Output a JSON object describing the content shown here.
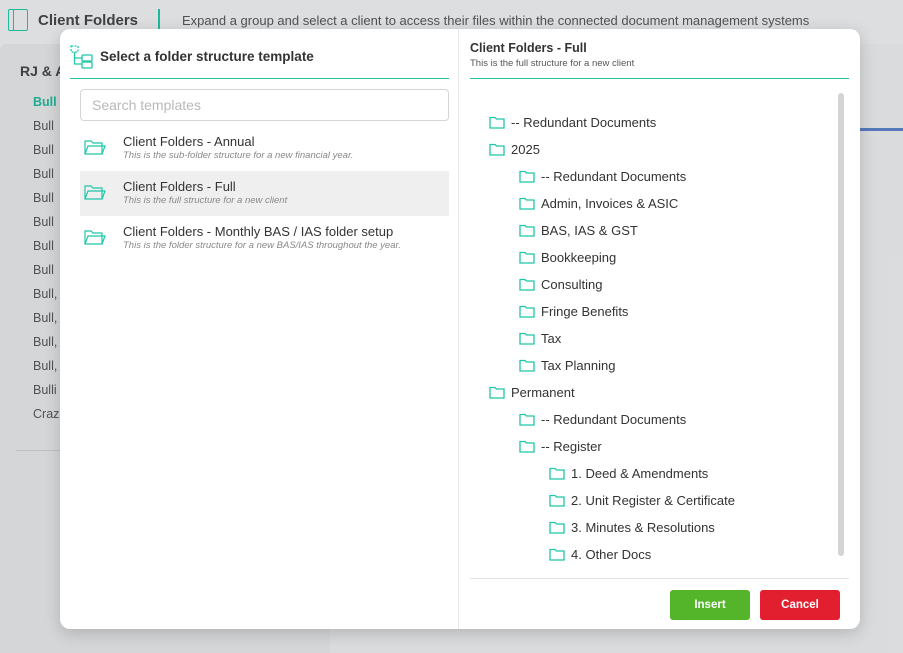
{
  "app": {
    "title": "Client Folders",
    "description": "Expand a group and select a client to access their files within the connected document management systems",
    "group_title": "RJ & A",
    "clients": [
      "Bull",
      "Bull",
      "Bull",
      "Bull",
      "Bull",
      "Bull",
      "Bull",
      "Bull",
      "Bull,",
      "Bull,",
      "Bull,",
      "Bull,",
      "Bulli",
      "Craz"
    ]
  },
  "modal": {
    "left_title": "Select a folder structure template",
    "search": {
      "placeholder": "Search templates",
      "value": ""
    },
    "templates": [
      {
        "name": "Client Folders - Annual",
        "desc": "This is the sub-folder structure for a new financial year.",
        "selected": false
      },
      {
        "name": "Client Folders - Full",
        "desc": "This is the full structure for a new client",
        "selected": true
      },
      {
        "name": "Client Folders - Monthly BAS / IAS folder setup",
        "desc": "This is the folder structure for a new BAS/IAS throughout the year.",
        "selected": false
      }
    ],
    "preview_title": "Client Folders - Full",
    "preview_subtitle": "This is the full structure for a new client",
    "tree": [
      {
        "name": "-- Redundant Documents",
        "level": 0
      },
      {
        "name": "2025",
        "level": 0
      },
      {
        "name": "-- Redundant Documents",
        "level": 1
      },
      {
        "name": "Admin, Invoices & ASIC",
        "level": 1
      },
      {
        "name": "BAS, IAS & GST",
        "level": 1
      },
      {
        "name": "Bookkeeping",
        "level": 1
      },
      {
        "name": "Consulting",
        "level": 1
      },
      {
        "name": "Fringe Benefits",
        "level": 1
      },
      {
        "name": "Tax",
        "level": 1
      },
      {
        "name": "Tax Planning",
        "level": 1
      },
      {
        "name": "Permanent",
        "level": 0
      },
      {
        "name": "-- Redundant Documents",
        "level": 1
      },
      {
        "name": "-- Register",
        "level": 1
      },
      {
        "name": "1. Deed & Amendments",
        "level": 2
      },
      {
        "name": "2. Unit Register & Certificate",
        "level": 2
      },
      {
        "name": "3. Minutes & Resolutions",
        "level": 2
      },
      {
        "name": "4. Other Docs",
        "level": 2
      }
    ],
    "buttons": {
      "insert": "Insert",
      "cancel": "Cancel"
    }
  },
  "colors": {
    "accent": "#1fc7a8",
    "insert": "#55b52a",
    "cancel": "#e21f2e"
  }
}
